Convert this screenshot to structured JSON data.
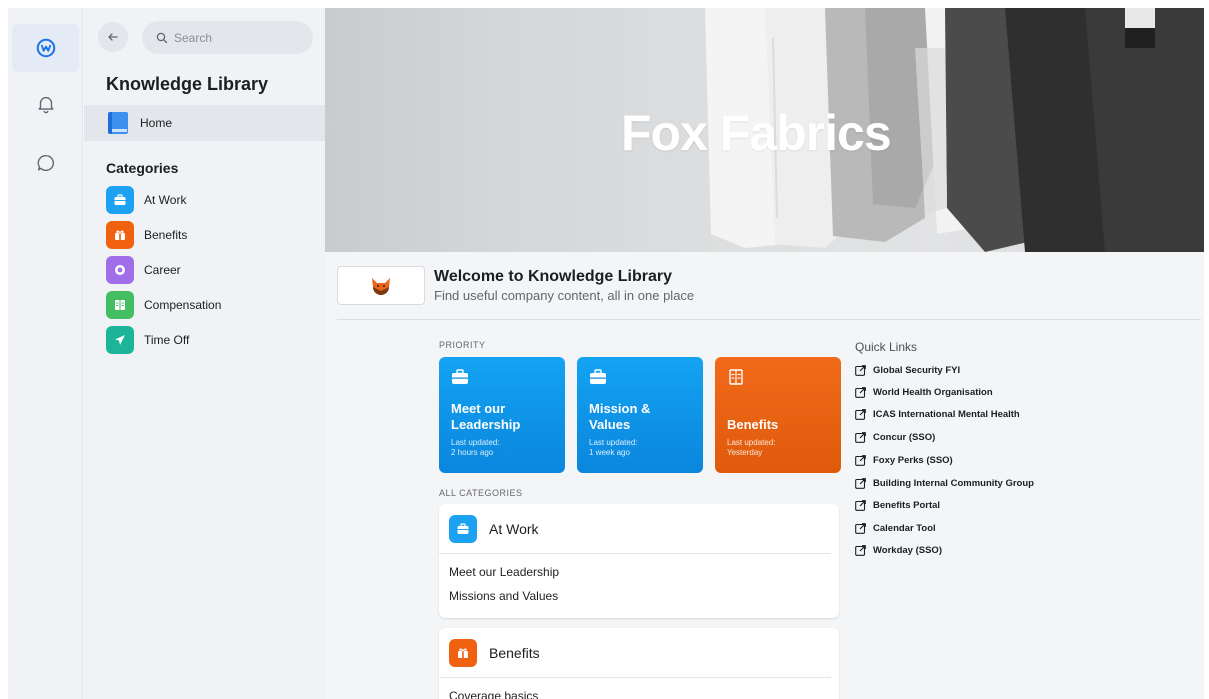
{
  "sidebar": {
    "search_placeholder": "Search",
    "title": "Knowledge Library",
    "home_label": "Home",
    "categories_heading": "Categories",
    "categories": [
      {
        "label": "At Work",
        "color": "#1da1f2",
        "icon": "briefcase-icon"
      },
      {
        "label": "Benefits",
        "color": "#f0620f",
        "icon": "gift-icon"
      },
      {
        "label": "Career",
        "color": "#a06ee8",
        "icon": "target-icon"
      },
      {
        "label": "Compensation",
        "color": "#45bd62",
        "icon": "ledger-icon"
      },
      {
        "label": "Time Off",
        "color": "#1cb59a",
        "icon": "airplane-icon"
      }
    ]
  },
  "hero": {
    "title": "Fox Fabrics"
  },
  "welcome": {
    "title": "Welcome to Knowledge Library",
    "subtitle": "Find useful company content, all in one place"
  },
  "priority": {
    "label": "PRIORITY",
    "cards": [
      {
        "title_line1": "Meet our",
        "title_line2": "Leadership",
        "updated_label": "Last updated:",
        "updated_value": "2 hours ago",
        "color": "#0f94e8",
        "icon": "briefcase-icon"
      },
      {
        "title_line1": "Mission &",
        "title_line2": "Values",
        "updated_label": "Last updated:",
        "updated_value": "1 week ago",
        "color": "#0f94e8",
        "icon": "briefcase-icon"
      },
      {
        "title_line1": "Benefits",
        "title_line2": "",
        "updated_label": "Last updated:",
        "updated_value": "Yesterday",
        "color": "#e8600f",
        "icon": "ledger-icon"
      }
    ]
  },
  "all_categories": {
    "label": "ALL CATEGORIES",
    "cards": [
      {
        "name": "At Work",
        "links": [
          "Meet our Leadership",
          "Missions and Values"
        ]
      },
      {
        "name": "Benefits",
        "links": [
          "Coverage basics"
        ]
      }
    ]
  },
  "quick_links": {
    "heading": "Quick Links",
    "items": [
      "Global Security FYI",
      "World Health Organisation",
      "ICAS International Mental Health",
      "Concur (SSO)",
      "Foxy Perks (SSO)",
      "Building Internal Community Group",
      "Benefits Portal",
      "Calendar Tool",
      "Workday (SSO)"
    ]
  }
}
